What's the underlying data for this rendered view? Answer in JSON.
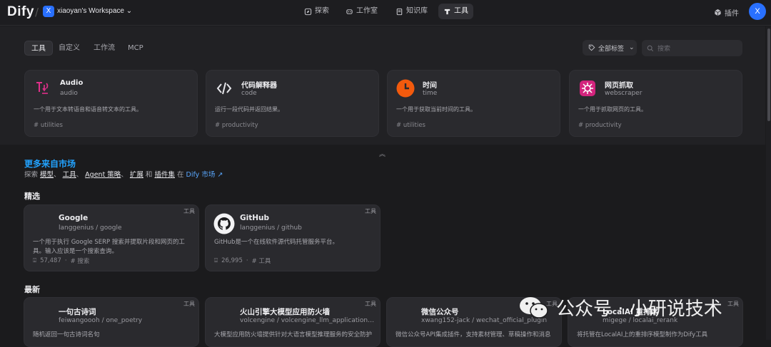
{
  "app": {
    "logo": "Dify",
    "workspace_initial": "X",
    "workspace_name": "xiaoyan's Workspace",
    "user_initial": "X"
  },
  "nav": {
    "explore": "探索",
    "studio": "工作室",
    "knowledge": "知识库",
    "tools": "工具",
    "plugins": "插件"
  },
  "tabs": [
    "工具",
    "自定义",
    "工作流",
    "MCP"
  ],
  "filter": {
    "tags_label": "全部标签",
    "search_placeholder": "搜索"
  },
  "tools": [
    {
      "name": "Audio",
      "id": "audio",
      "desc": "一个用于文本转语音和语音转文本的工具。",
      "tag": "# utilities",
      "icon": "audio-icon"
    },
    {
      "name": "代码解释器",
      "id": "code",
      "desc": "运行一段代码并返回结果。",
      "tag": "# productivity",
      "icon": "code-icon"
    },
    {
      "name": "时间",
      "id": "time",
      "desc": "一个用于获取当前时间的工具。",
      "tag": "# utilities",
      "icon": "clock-icon"
    },
    {
      "name": "网页抓取",
      "id": "webscraper",
      "desc": "一个用于抓取网页的工具。",
      "tag": "# productivity",
      "icon": "webscraper-icon"
    }
  ],
  "marketplace": {
    "title": "更多来自市场",
    "sub_prefix": "探索",
    "models": "模型",
    "tools": "工具",
    "agent": "Agent 策略",
    "ext": "扩展",
    "and": "和",
    "bundles": "插件集",
    "in": "在",
    "link": "Dify 市场 ↗",
    "comma": "、"
  },
  "sections": {
    "featured": "精选",
    "latest": "最新"
  },
  "featured": [
    {
      "badge": "工具",
      "name": "Google",
      "org": "langgenius / google",
      "desc": "一个用于执行 Google SERP 搜索并提取片段和网页的工具。输入应该是一个搜索查询。",
      "installs": "57,487",
      "tag": "# 搜索"
    },
    {
      "badge": "工具",
      "name": "GitHub",
      "org": "langgenius / github",
      "desc": "GitHub是一个在线软件源代码托管服务平台。",
      "installs": "26,995",
      "tag": "# 工具"
    }
  ],
  "latest": [
    {
      "badge": "工具",
      "name": "一句古诗词",
      "org": "feiwangoooh / one_poetry",
      "desc": "随机返回一句古诗词名句"
    },
    {
      "badge": "工具",
      "name": "火山引擎大模型应用防火墙",
      "org": "volcengine / volcengine_llm_application_fire...",
      "desc": "大模型应用防火墙提供针对大语言模型推理服务的安全防护"
    },
    {
      "badge": "工具",
      "name": "微信公众号",
      "org": "xwang152-jack / wechat_official_plugin",
      "desc": "微信公众号API集成插件，支持素材管理、草稿操作和消息"
    },
    {
      "badge": "工具",
      "name": "LocalAI 重排序",
      "org": "migege / localai_rerank",
      "desc": "将托管在LocalAI上的重排序模型制作为Dify工具"
    }
  ],
  "watermark": "公众号 · 小研说技术"
}
